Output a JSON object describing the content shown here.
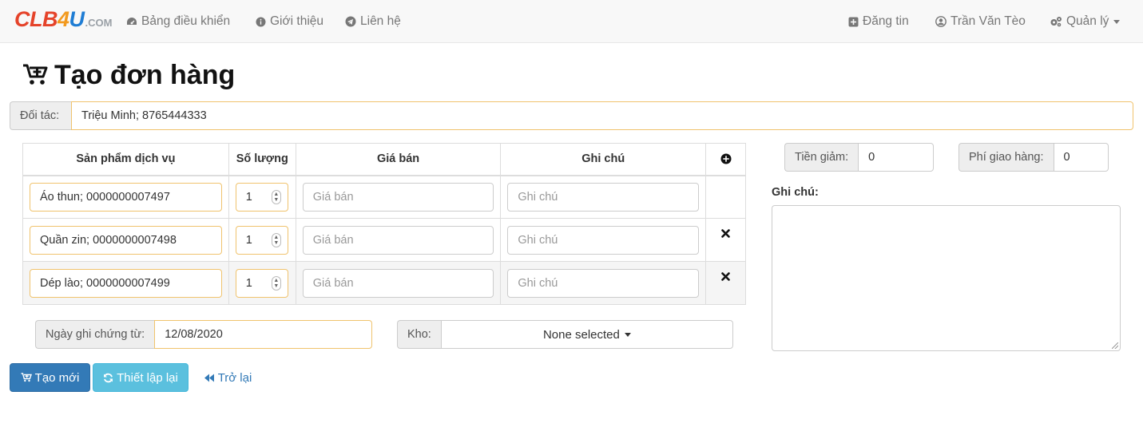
{
  "navbar": {
    "brand": {
      "part1": "CLB",
      "part2": "4",
      "part3": "U",
      "suffix": ".COM"
    },
    "left_items": [
      {
        "label": "Bảng điều khiển",
        "icon": "dashboard-icon"
      },
      {
        "label": "Giới thiệu",
        "icon": "info-circle-icon"
      },
      {
        "label": "Liên hệ",
        "icon": "telegram-icon"
      }
    ],
    "right_items": [
      {
        "label": "Đăng tin",
        "icon": "plus-square-icon"
      },
      {
        "label": "Trần Văn Tèo",
        "icon": "user-circle-icon"
      },
      {
        "label": "Quản lý",
        "icon": "gears-icon"
      }
    ]
  },
  "page": {
    "title": "Tạo đơn hàng"
  },
  "partner": {
    "label": "Đối tác:",
    "value": "Triệu Minh;  8765444333"
  },
  "table": {
    "headers": [
      "Sản phẩm dịch vụ",
      "Số lượng",
      "Giá bán",
      "Ghi chú"
    ],
    "rows": [
      {
        "product": "Áo thun; 0000000007497",
        "qty": "1",
        "price_placeholder": "Giá bán",
        "note_placeholder": "Ghi chú",
        "removable": false
      },
      {
        "product": "Quần zin; 0000000007498",
        "qty": "1",
        "price_placeholder": "Giá bán",
        "note_placeholder": "Ghi chú",
        "removable": true
      },
      {
        "product": "Dép lào; 0000000007499",
        "qty": "1",
        "price_placeholder": "Giá bán",
        "note_placeholder": "Ghi chú",
        "removable": true
      }
    ]
  },
  "discount": {
    "label": "Tiền giảm:",
    "value": "0"
  },
  "shipping": {
    "label": "Phí giao hàng:",
    "value": "0"
  },
  "note": {
    "label": "Ghi chú:",
    "value": ""
  },
  "voucher_date": {
    "label": "Ngày ghi chứng từ:",
    "value": "12/08/2020"
  },
  "warehouse": {
    "label": "Kho:",
    "value": "None selected"
  },
  "actions": {
    "create": "Tạo mới",
    "reset": "Thiết lập lại",
    "back": "Trở lại"
  },
  "colors": {
    "primary": "#337ab7",
    "info": "#5bc0de",
    "warning_border": "#f0c36d"
  }
}
